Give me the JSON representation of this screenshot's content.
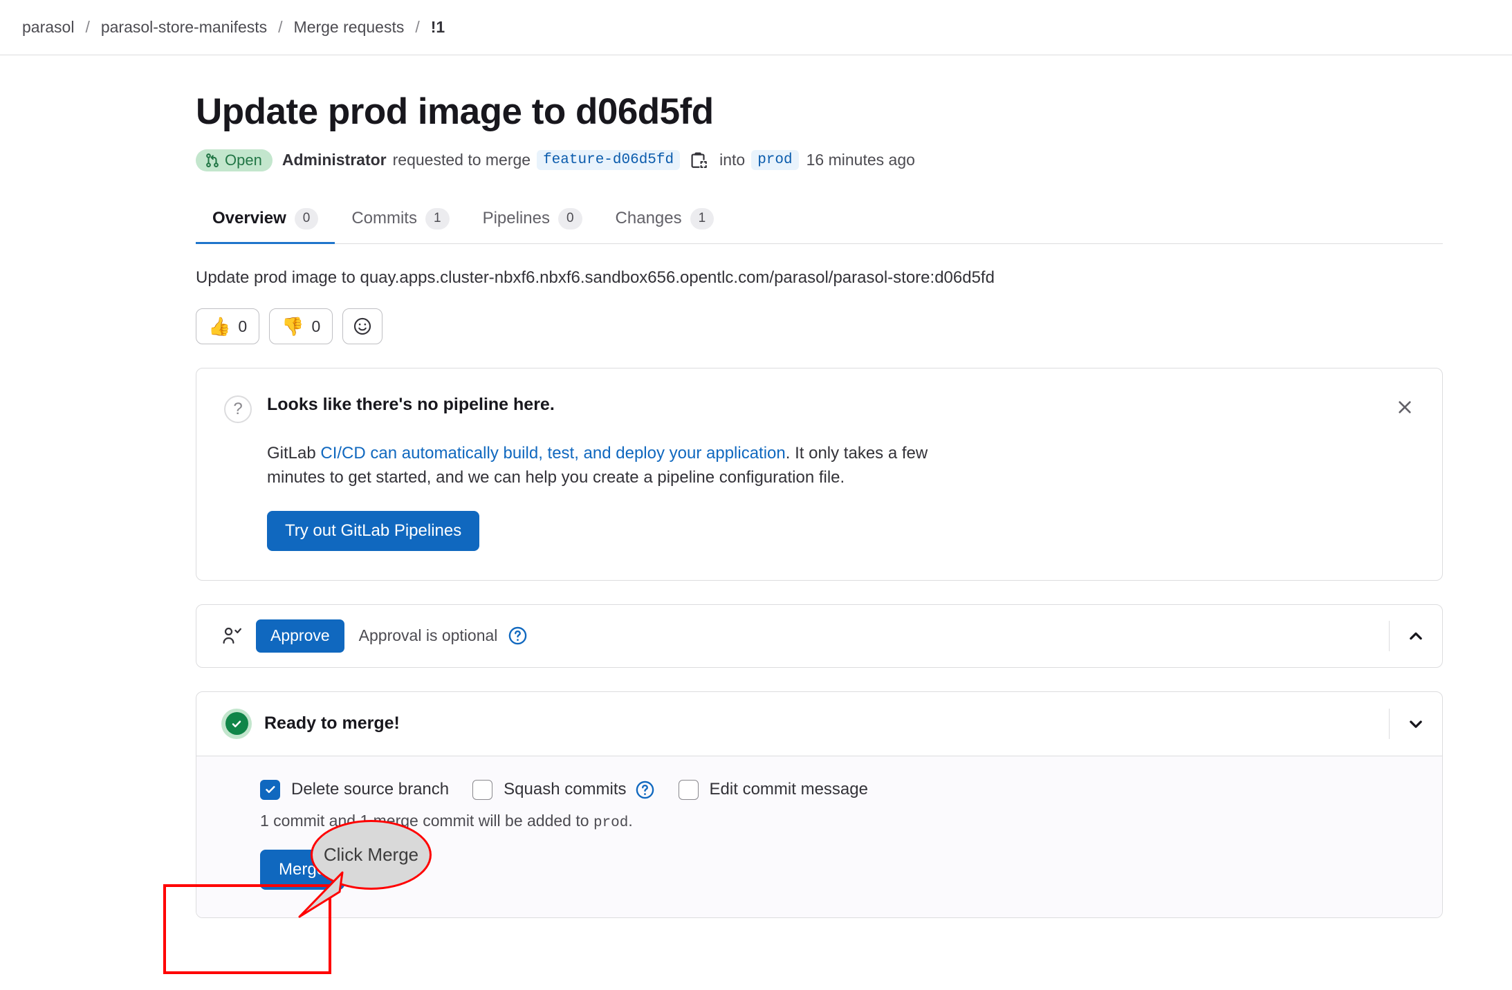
{
  "breadcrumb": {
    "items": [
      {
        "label": "parasol"
      },
      {
        "label": "parasol-store-manifests"
      },
      {
        "label": "Merge requests"
      },
      {
        "label": "!1"
      }
    ],
    "separator": "/"
  },
  "merge_request": {
    "title": "Update prod image to d06d5fd",
    "state_badge": "Open",
    "author": "Administrator",
    "action_text": "requested to merge",
    "source_branch": "feature-d06d5fd",
    "into_text": "into",
    "target_branch": "prod",
    "timestamp": "16 minutes ago",
    "copy_icon": "copy-icon",
    "state_icon": "merge-request-icon"
  },
  "tabs": [
    {
      "label": "Overview",
      "count": "0",
      "active": true
    },
    {
      "label": "Commits",
      "count": "1",
      "active": false
    },
    {
      "label": "Pipelines",
      "count": "0",
      "active": false
    },
    {
      "label": "Changes",
      "count": "1",
      "active": false
    }
  ],
  "description": "Update prod image to quay.apps.cluster-nbxf6.nbxf6.sandbox656.opentlc.com/parasol/parasol-store:d06d5fd",
  "reactions": [
    {
      "emoji": "👍",
      "count": "0",
      "name": "thumbsup-reaction"
    },
    {
      "emoji": "👎",
      "count": "0",
      "name": "thumbsdown-reaction"
    }
  ],
  "emoji_picker": {
    "icon": "smiley-icon"
  },
  "pipeline_widget": {
    "icon": "question-mark-icon",
    "title": "Looks like there's no pipeline here.",
    "body_prefix": "GitLab ",
    "body_link": "CI/CD can automatically build, test, and deploy your application",
    "body_suffix": ". It only takes a few minutes to get started, and we can help you create a pipeline configuration file.",
    "button_label": "Try out GitLab Pipelines",
    "close_icon": "close-icon"
  },
  "approval_widget": {
    "icon": "user-check-icon",
    "approve_label": "Approve",
    "status_text": "Approval is optional",
    "help_icon": "question-circle-icon",
    "collapse_icon": "chevron-up-icon"
  },
  "merge_widget": {
    "status_icon": "check-circle-icon",
    "status_text": "Ready to merge!",
    "expand_icon": "chevron-down-icon",
    "options": [
      {
        "label": "Delete source branch",
        "checked": true,
        "name": "delete-source-branch-checkbox"
      },
      {
        "label": "Squash commits",
        "checked": false,
        "name": "squash-commits-checkbox",
        "help_icon": "question-circle-icon"
      },
      {
        "label": "Edit commit message",
        "checked": false,
        "name": "edit-commit-message-checkbox"
      }
    ],
    "commit_note_prefix": "1 commit and 1 merge commit will be added to ",
    "commit_note_code": "prod",
    "commit_note_suffix": ".",
    "merge_label": "Merge"
  },
  "annotations": {
    "bubble_text": "Click Merge",
    "highlight_color": "#ff0000",
    "bubble_fill": "#d9d9d9"
  },
  "colors": {
    "primary_blue": "#1068bf",
    "link_blue": "#1f75cb",
    "open_green_bg": "#c3e6cd",
    "open_green_fg": "#217645",
    "success_green": "#108548"
  }
}
